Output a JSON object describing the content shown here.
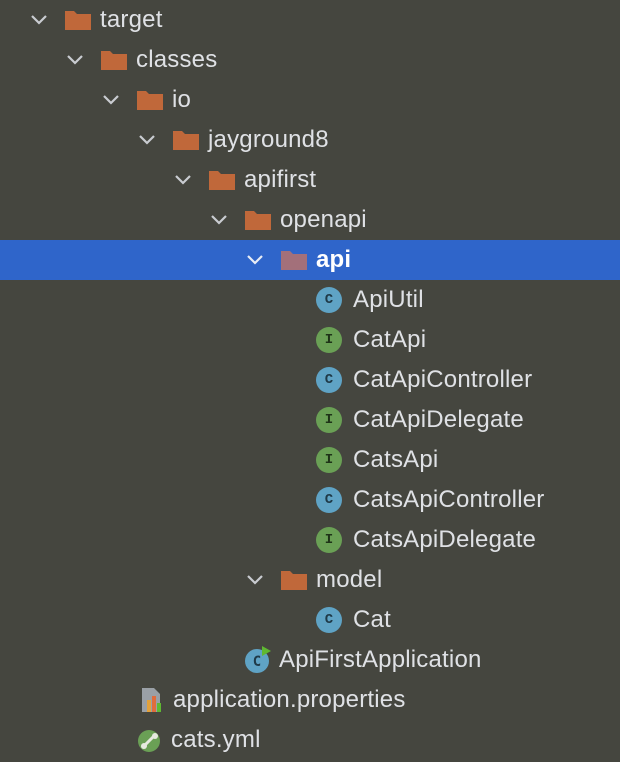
{
  "tree": {
    "target": "target",
    "classes": "classes",
    "io": "io",
    "jayground8": "jayground8",
    "apifirst": "apifirst",
    "openapi": "openapi",
    "api": "api",
    "api_children": [
      "ApiUtil",
      "CatApi",
      "CatApiController",
      "CatApiDelegate",
      "CatsApi",
      "CatsApiController",
      "CatsApiDelegate"
    ],
    "model": "model",
    "model_children": [
      "Cat"
    ],
    "app_class": "ApiFirstApplication",
    "properties_file": "application.properties",
    "yaml_file": "cats.yml"
  },
  "icons": {
    "class": "C",
    "interface": "I"
  },
  "colors": {
    "background": "#45463f",
    "selection": "#2f65ca",
    "folder": "#c0683a",
    "class_icon": "#5fa3c5",
    "interface_icon": "#6aa055"
  }
}
